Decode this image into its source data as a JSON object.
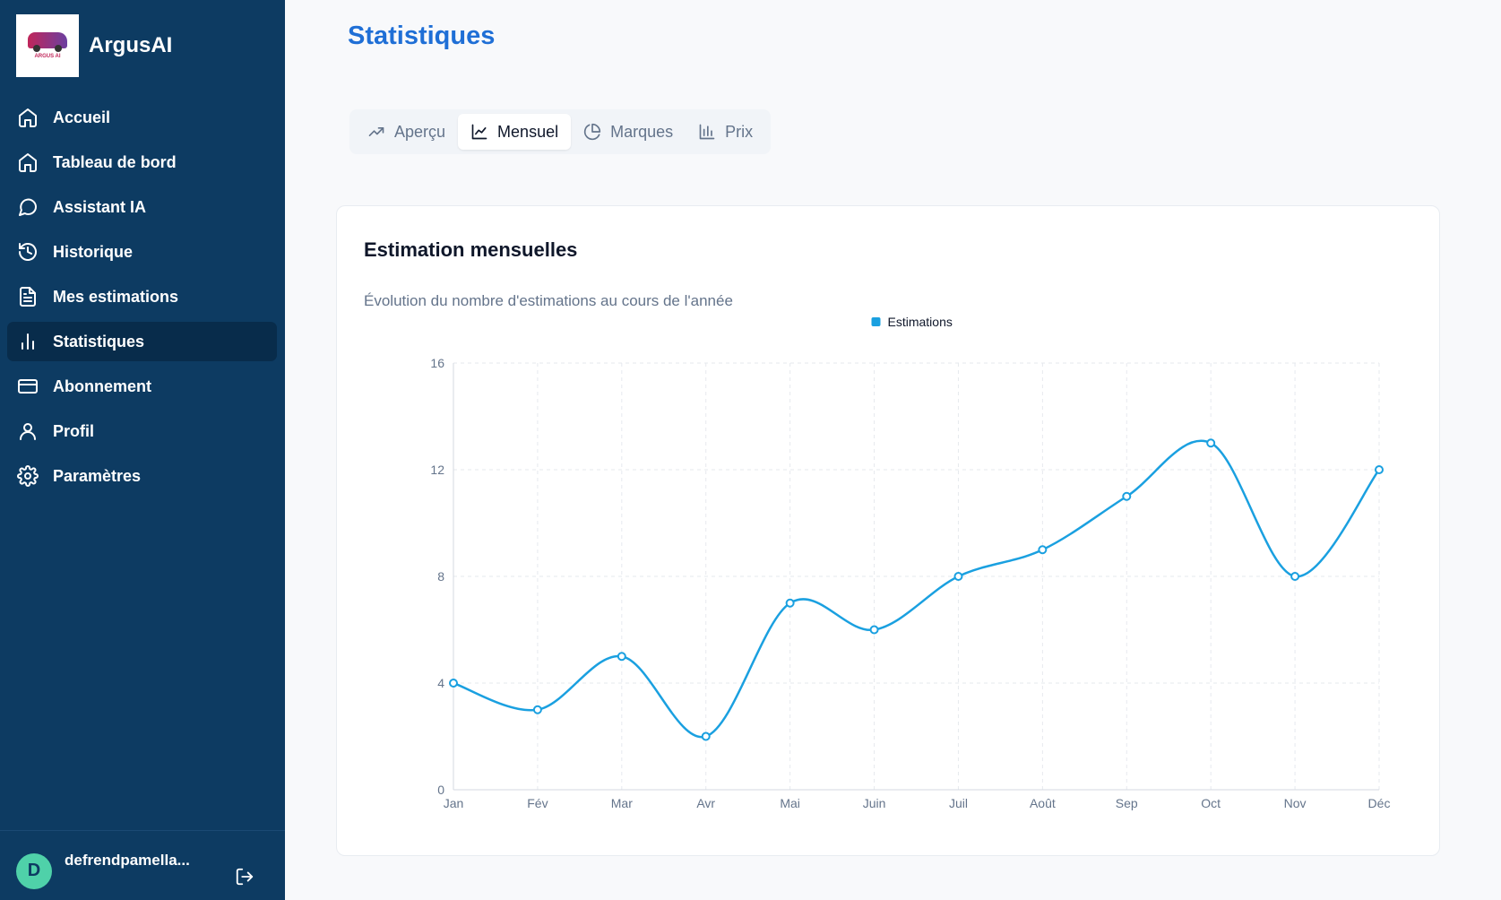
{
  "brand": {
    "name": "ArgusAI",
    "logo_text": "ARGUS AI"
  },
  "sidebar": {
    "items": [
      {
        "label": "Accueil",
        "icon": "home-icon",
        "active": false
      },
      {
        "label": "Tableau de bord",
        "icon": "home-icon",
        "active": false
      },
      {
        "label": "Assistant IA",
        "icon": "chat-bubble-icon",
        "active": false
      },
      {
        "label": "Historique",
        "icon": "history-icon",
        "active": false
      },
      {
        "label": "Mes estimations",
        "icon": "document-icon",
        "active": false
      },
      {
        "label": "Statistiques",
        "icon": "bar-chart-icon",
        "active": true
      },
      {
        "label": "Abonnement",
        "icon": "credit-card-icon",
        "active": false
      },
      {
        "label": "Profil",
        "icon": "user-icon",
        "active": false
      },
      {
        "label": "Paramètres",
        "icon": "gear-icon",
        "active": false
      }
    ]
  },
  "user": {
    "initial": "D",
    "name": "defrendpamella..."
  },
  "main": {
    "title": "Statistiques",
    "tabs": [
      {
        "label": "Aperçu",
        "icon": "trending-up-icon",
        "active": false
      },
      {
        "label": "Mensuel",
        "icon": "line-chart-icon",
        "active": true
      },
      {
        "label": "Marques",
        "icon": "pie-chart-icon",
        "active": false
      },
      {
        "label": "Prix",
        "icon": "bar-chart-icon",
        "active": false
      }
    ],
    "card": {
      "title": "Estimation mensuelles",
      "description": "Évolution du nombre d'estimations au cours de l'année"
    }
  },
  "colors": {
    "sidebar": "#0d3b62",
    "accent": "#1f6fd6",
    "series": "#1aa0e0"
  },
  "chart_data": {
    "type": "line",
    "categories": [
      "Jan",
      "Fév",
      "Mar",
      "Avr",
      "Mai",
      "Juin",
      "Juil",
      "Août",
      "Sep",
      "Oct",
      "Nov",
      "Déc"
    ],
    "series": [
      {
        "name": "Estimations",
        "values": [
          4,
          3,
          5,
          2,
          7,
          6,
          8,
          9,
          11,
          13,
          8,
          12
        ]
      }
    ],
    "yticks": [
      0,
      4,
      8,
      12,
      16
    ],
    "ylim": [
      0,
      16
    ],
    "grid": true,
    "legend": "top-center",
    "curve": "smooth"
  }
}
